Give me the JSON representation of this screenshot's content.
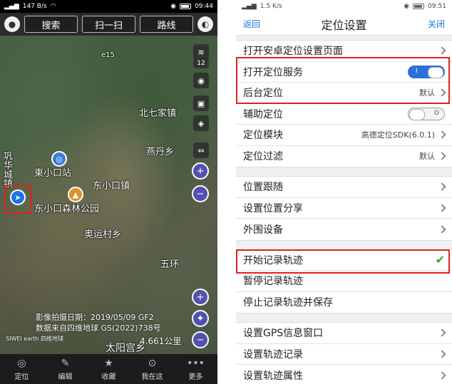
{
  "left": {
    "status": {
      "net": "147 B/s",
      "time": "09:44"
    },
    "topbar": {
      "search": "搜索",
      "scan": "扫一扫",
      "route": "路线"
    },
    "map": {
      "labels": [
        "北七家镇",
        "燕丹乡",
        "巩华城镇",
        "東小口站",
        "东小口镇",
        "东小口森林公园",
        "奥运村乡",
        "五环",
        "太阳宫乡"
      ],
      "sidebtn_level": "12",
      "road_label": "e15",
      "capture_date": "影像拍摄日期：2019/05/09 GF2",
      "data_source": "数据来自四维地球 GS(2022)738号",
      "scale": "4.661公里",
      "logo_text": "SIWEI earth 四维地球"
    },
    "tabs": [
      "定位",
      "编辑",
      "收藏",
      "我在这",
      "更多"
    ]
  },
  "right": {
    "status": {
      "net": "1.5 K/s",
      "time": "09:51"
    },
    "nav": {
      "back": "返回",
      "title": "定位设置",
      "close": "关闭"
    },
    "group1": {
      "open_android": "打开安卓定位设置页面",
      "open_location": "打开定位服务",
      "open_location_mark": "I",
      "background": "后台定位",
      "background_val": "默认",
      "assist": "辅助定位",
      "assist_mark": "O",
      "module": "定位模块",
      "module_val": "高德定位SDK(6.0.1)",
      "filter": "定位过滤",
      "filter_val": "默认"
    },
    "group2": {
      "follow": "位置跟随",
      "share": "设置位置分享",
      "peripheral": "外围设备"
    },
    "group3": {
      "start": "开始记录轨迹",
      "pause": "暂停记录轨迹",
      "stop": "停止记录轨迹并保存"
    },
    "group4": {
      "gps_window": "设置GPS信息窗口",
      "track_record": "设置轨迹记录",
      "track_attr": "设置轨迹属性"
    }
  },
  "colors": {
    "accent": "#2f6fd8",
    "highlight": "#e02020",
    "check": "#2aa62a"
  }
}
